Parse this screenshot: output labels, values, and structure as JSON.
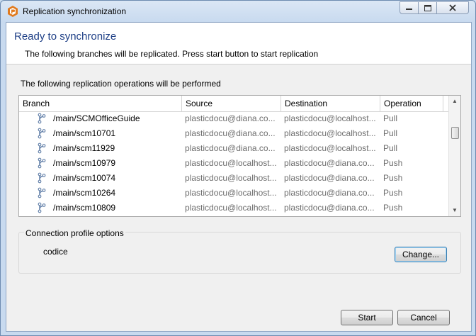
{
  "window": {
    "title": "Replication synchronization"
  },
  "header": {
    "title": "Ready to synchronize",
    "subtitle": "The following branches will be replicated. Press start button to start replication"
  },
  "operations": {
    "label": "The following replication operations will be performed",
    "columns": {
      "branch": "Branch",
      "source": "Source",
      "destination": "Destination",
      "operation": "Operation"
    },
    "rows": [
      {
        "branch": "/main/SCMOfficeGuide",
        "source": "plasticdocu@diana.co...",
        "destination": "plasticdocu@localhost...",
        "operation": "Pull"
      },
      {
        "branch": "/main/scm10701",
        "source": "plasticdocu@diana.co...",
        "destination": "plasticdocu@localhost...",
        "operation": "Pull"
      },
      {
        "branch": "/main/scm11929",
        "source": "plasticdocu@diana.co...",
        "destination": "plasticdocu@localhost...",
        "operation": "Pull"
      },
      {
        "branch": "/main/scm10979",
        "source": "plasticdocu@localhost...",
        "destination": "plasticdocu@diana.co...",
        "operation": "Push"
      },
      {
        "branch": "/main/scm10074",
        "source": "plasticdocu@localhost...",
        "destination": "plasticdocu@diana.co...",
        "operation": "Push"
      },
      {
        "branch": "/main/scm10264",
        "source": "plasticdocu@localhost...",
        "destination": "plasticdocu@diana.co...",
        "operation": "Push"
      },
      {
        "branch": "/main/scm10809",
        "source": "plasticdocu@localhost...",
        "destination": "plasticdocu@diana.co...",
        "operation": "Push"
      }
    ]
  },
  "connection": {
    "legend": "Connection profile options",
    "profile": "codice",
    "change_label": "Change..."
  },
  "footer": {
    "start_label": "Start",
    "cancel_label": "Cancel"
  },
  "icons": {
    "app": "plastic-logo-icon",
    "branch": "branch-icon"
  },
  "colors": {
    "header_title": "#1e3f86",
    "app_icon": "#e07a1f",
    "muted_text": "#6d6d6d"
  }
}
